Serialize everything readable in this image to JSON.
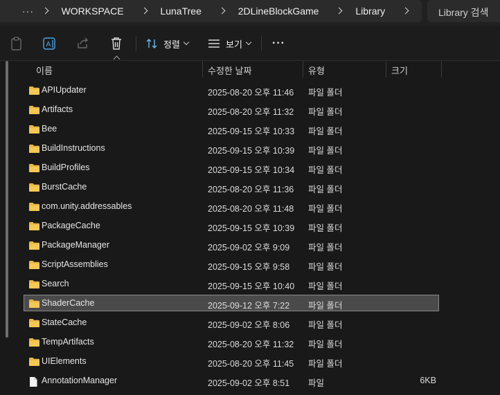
{
  "breadcrumb": {
    "more": "···",
    "items": [
      "WORKSPACE",
      "LunaTree",
      "2DLineBlockGame",
      "Library"
    ]
  },
  "search": {
    "placeholder": "Library 검색"
  },
  "toolbar": {
    "sort_label": "정렬",
    "view_label": "보기",
    "more_label": "···",
    "icons": [
      "clipboard-icon",
      "rename-icon",
      "share-icon",
      "delete-icon",
      "sort-icon",
      "view-icon"
    ]
  },
  "columns": {
    "name": "이름",
    "modified": "수정한 날짜",
    "type": "유형",
    "size": "크기"
  },
  "rows": [
    {
      "name": "APIUpdater",
      "date": "2025-08-20 오후 11:46",
      "type": "파일 폴더",
      "size": "",
      "kind": "folder"
    },
    {
      "name": "Artifacts",
      "date": "2025-08-20 오후 11:32",
      "type": "파일 폴더",
      "size": "",
      "kind": "folder"
    },
    {
      "name": "Bee",
      "date": "2025-09-15 오후 10:33",
      "type": "파일 폴더",
      "size": "",
      "kind": "folder"
    },
    {
      "name": "BuildInstructions",
      "date": "2025-09-15 오후 10:39",
      "type": "파일 폴더",
      "size": "",
      "kind": "folder"
    },
    {
      "name": "BuildProfiles",
      "date": "2025-09-15 오후 10:34",
      "type": "파일 폴더",
      "size": "",
      "kind": "folder"
    },
    {
      "name": "BurstCache",
      "date": "2025-08-20 오후 11:36",
      "type": "파일 폴더",
      "size": "",
      "kind": "folder"
    },
    {
      "name": "com.unity.addressables",
      "date": "2025-08-20 오후 11:48",
      "type": "파일 폴더",
      "size": "",
      "kind": "folder"
    },
    {
      "name": "PackageCache",
      "date": "2025-09-15 오후 10:39",
      "type": "파일 폴더",
      "size": "",
      "kind": "folder"
    },
    {
      "name": "PackageManager",
      "date": "2025-09-02 오후 9:09",
      "type": "파일 폴더",
      "size": "",
      "kind": "folder"
    },
    {
      "name": "ScriptAssemblies",
      "date": "2025-09-15 오후 9:58",
      "type": "파일 폴더",
      "size": "",
      "kind": "folder"
    },
    {
      "name": "Search",
      "date": "2025-09-15 오후 10:40",
      "type": "파일 폴더",
      "size": "",
      "kind": "folder"
    },
    {
      "name": "ShaderCache",
      "date": "2025-09-12 오후 7:22",
      "type": "파일 폴더",
      "size": "",
      "kind": "folder",
      "selected": true
    },
    {
      "name": "StateCache",
      "date": "2025-09-02 오후 8:06",
      "type": "파일 폴더",
      "size": "",
      "kind": "folder"
    },
    {
      "name": "TempArtifacts",
      "date": "2025-08-20 오후 11:32",
      "type": "파일 폴더",
      "size": "",
      "kind": "folder"
    },
    {
      "name": "UIElements",
      "date": "2025-08-20 오후 11:45",
      "type": "파일 폴더",
      "size": "",
      "kind": "folder"
    },
    {
      "name": "AnnotationManager",
      "date": "2025-09-02 오후 8:51",
      "type": "파일",
      "size": "6KB",
      "kind": "file"
    }
  ],
  "colors": {
    "background": "#191919",
    "folder": "#e8b84a",
    "selected": "#4a4a4a"
  }
}
